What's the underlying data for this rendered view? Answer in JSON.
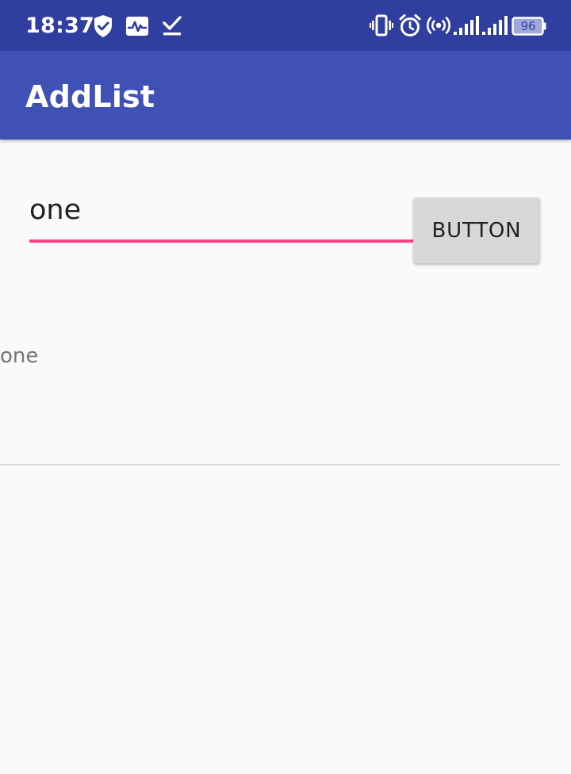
{
  "status_bar": {
    "time": "18:37",
    "battery_level": "96",
    "left_icons": [
      "shield-check-icon",
      "activity-monitor-icon",
      "download-done-icon"
    ],
    "right_icons": [
      "vibrate-icon",
      "alarm-icon",
      "hotspot-icon",
      "signal-icon",
      "signal-icon",
      "battery-icon"
    ]
  },
  "app_bar": {
    "title": "AddList",
    "color": "#3f51b5",
    "status_color": "#303f9f"
  },
  "form": {
    "input_value": "one",
    "button_label": "Button",
    "accent_color": "#ff4081"
  },
  "list": {
    "items": [
      {
        "label": "one"
      }
    ]
  }
}
